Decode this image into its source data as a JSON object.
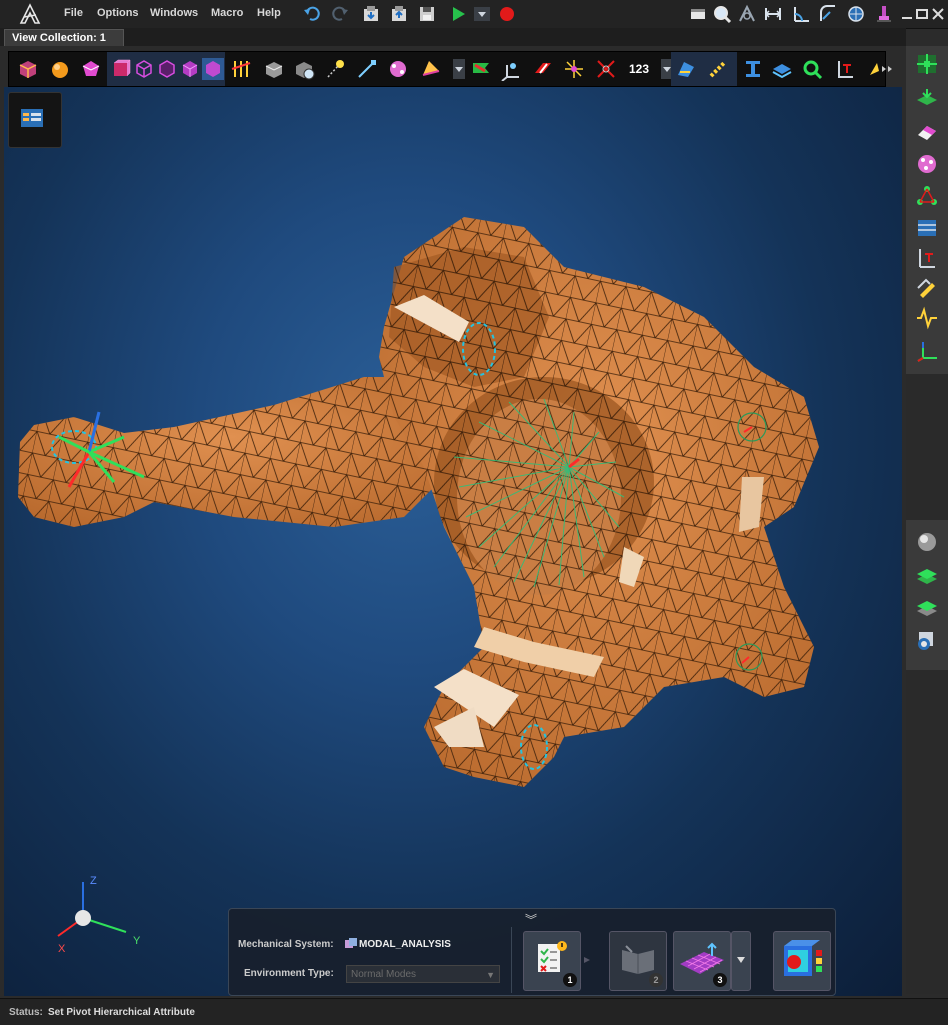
{
  "menu": {
    "items": [
      "File",
      "Options",
      "Windows",
      "Macro",
      "Help"
    ]
  },
  "tab": {
    "label": "View Collection: 1"
  },
  "toolbar": {
    "number_label": "123"
  },
  "triad": {
    "z": "Z",
    "x": "X",
    "y": "Y"
  },
  "process": {
    "mech_label": "Mechanical System:",
    "mech_value": "MODAL_ANALYSIS",
    "env_label": "Environment Type:",
    "env_value": "Normal Modes",
    "steps": [
      "1",
      "2",
      "3"
    ]
  },
  "status": {
    "label": "Status:",
    "text": "Set Pivot Hierarchical Attribute"
  },
  "colors": {
    "mesh": "#c8773a",
    "background": "#1f4a7e",
    "highlight": "#25c3e0"
  }
}
